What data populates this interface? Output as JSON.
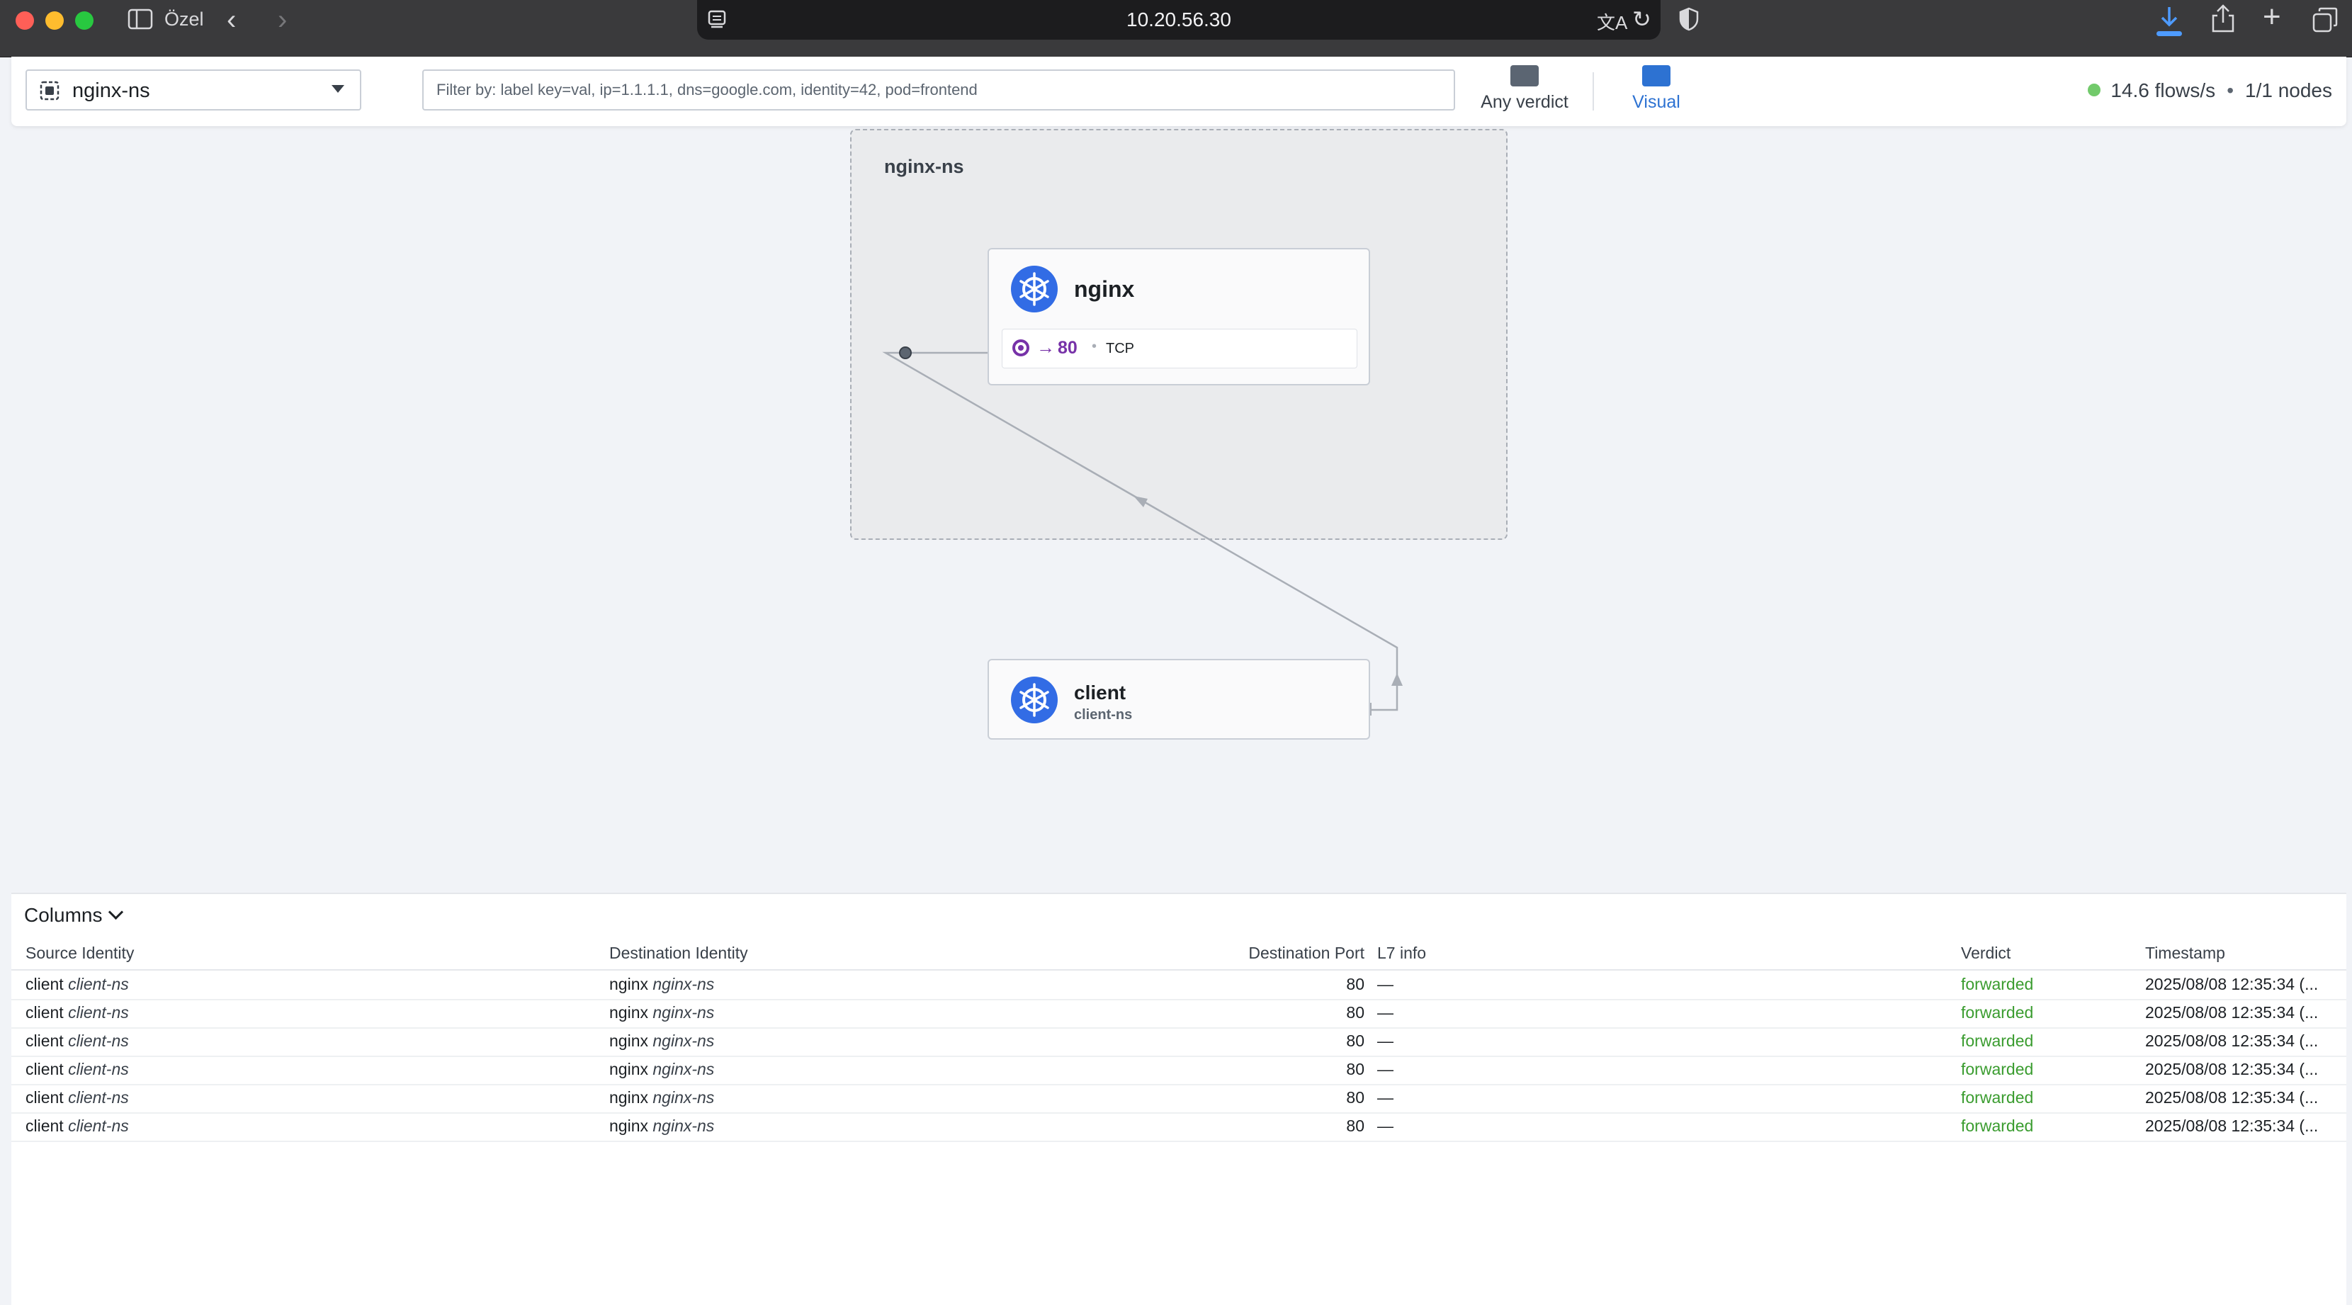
{
  "browser": {
    "profile_label": "Özel",
    "url": "10.20.56.30"
  },
  "toolbar": {
    "namespace": "nginx-ns",
    "filter_placeholder": "Filter by: label key=val, ip=1.1.1.1, dns=google.com, identity=42, pod=frontend",
    "verdict_label": "Any verdict",
    "visual_label": "Visual",
    "flows_rate": "14.6 flows/s",
    "separator": "•",
    "nodes": "1/1 nodes"
  },
  "map": {
    "namespace_box": "nginx-ns",
    "nginx": {
      "name": "nginx",
      "port_arrow": "→",
      "port": "80",
      "bullet": "•",
      "protocol": "TCP"
    },
    "client": {
      "name": "client",
      "namespace": "client-ns"
    }
  },
  "flows": {
    "columns_label": "Columns",
    "headers": [
      "Source Identity",
      "Destination Identity",
      "Destination Port",
      "L7 info",
      "Verdict",
      "Timestamp"
    ],
    "rows": [
      {
        "src": "client",
        "src_ns": "client-ns",
        "dst": "nginx",
        "dst_ns": "nginx-ns",
        "port": "80",
        "l7": "—",
        "verdict": "forwarded",
        "ts": "2025/08/08 12:35:34 (..."
      },
      {
        "src": "client",
        "src_ns": "client-ns",
        "dst": "nginx",
        "dst_ns": "nginx-ns",
        "port": "80",
        "l7": "—",
        "verdict": "forwarded",
        "ts": "2025/08/08 12:35:34 (..."
      },
      {
        "src": "client",
        "src_ns": "client-ns",
        "dst": "nginx",
        "dst_ns": "nginx-ns",
        "port": "80",
        "l7": "—",
        "verdict": "forwarded",
        "ts": "2025/08/08 12:35:34 (..."
      },
      {
        "src": "client",
        "src_ns": "client-ns",
        "dst": "nginx",
        "dst_ns": "nginx-ns",
        "port": "80",
        "l7": "—",
        "verdict": "forwarded",
        "ts": "2025/08/08 12:35:34 (..."
      },
      {
        "src": "client",
        "src_ns": "client-ns",
        "dst": "nginx",
        "dst_ns": "nginx-ns",
        "port": "80",
        "l7": "—",
        "verdict": "forwarded",
        "ts": "2025/08/08 12:35:34 (..."
      },
      {
        "src": "client",
        "src_ns": "client-ns",
        "dst": "nginx",
        "dst_ns": "nginx-ns",
        "port": "80",
        "l7": "—",
        "verdict": "forwarded",
        "ts": "2025/08/08 12:35:34 (..."
      }
    ]
  },
  "colors": {
    "accent": "#2d72d2",
    "verdict_forwarded": "#3a9c2f",
    "port": "#7732a8",
    "k8s_blue": "#326ce5",
    "status_ok": "#72ca6b"
  }
}
